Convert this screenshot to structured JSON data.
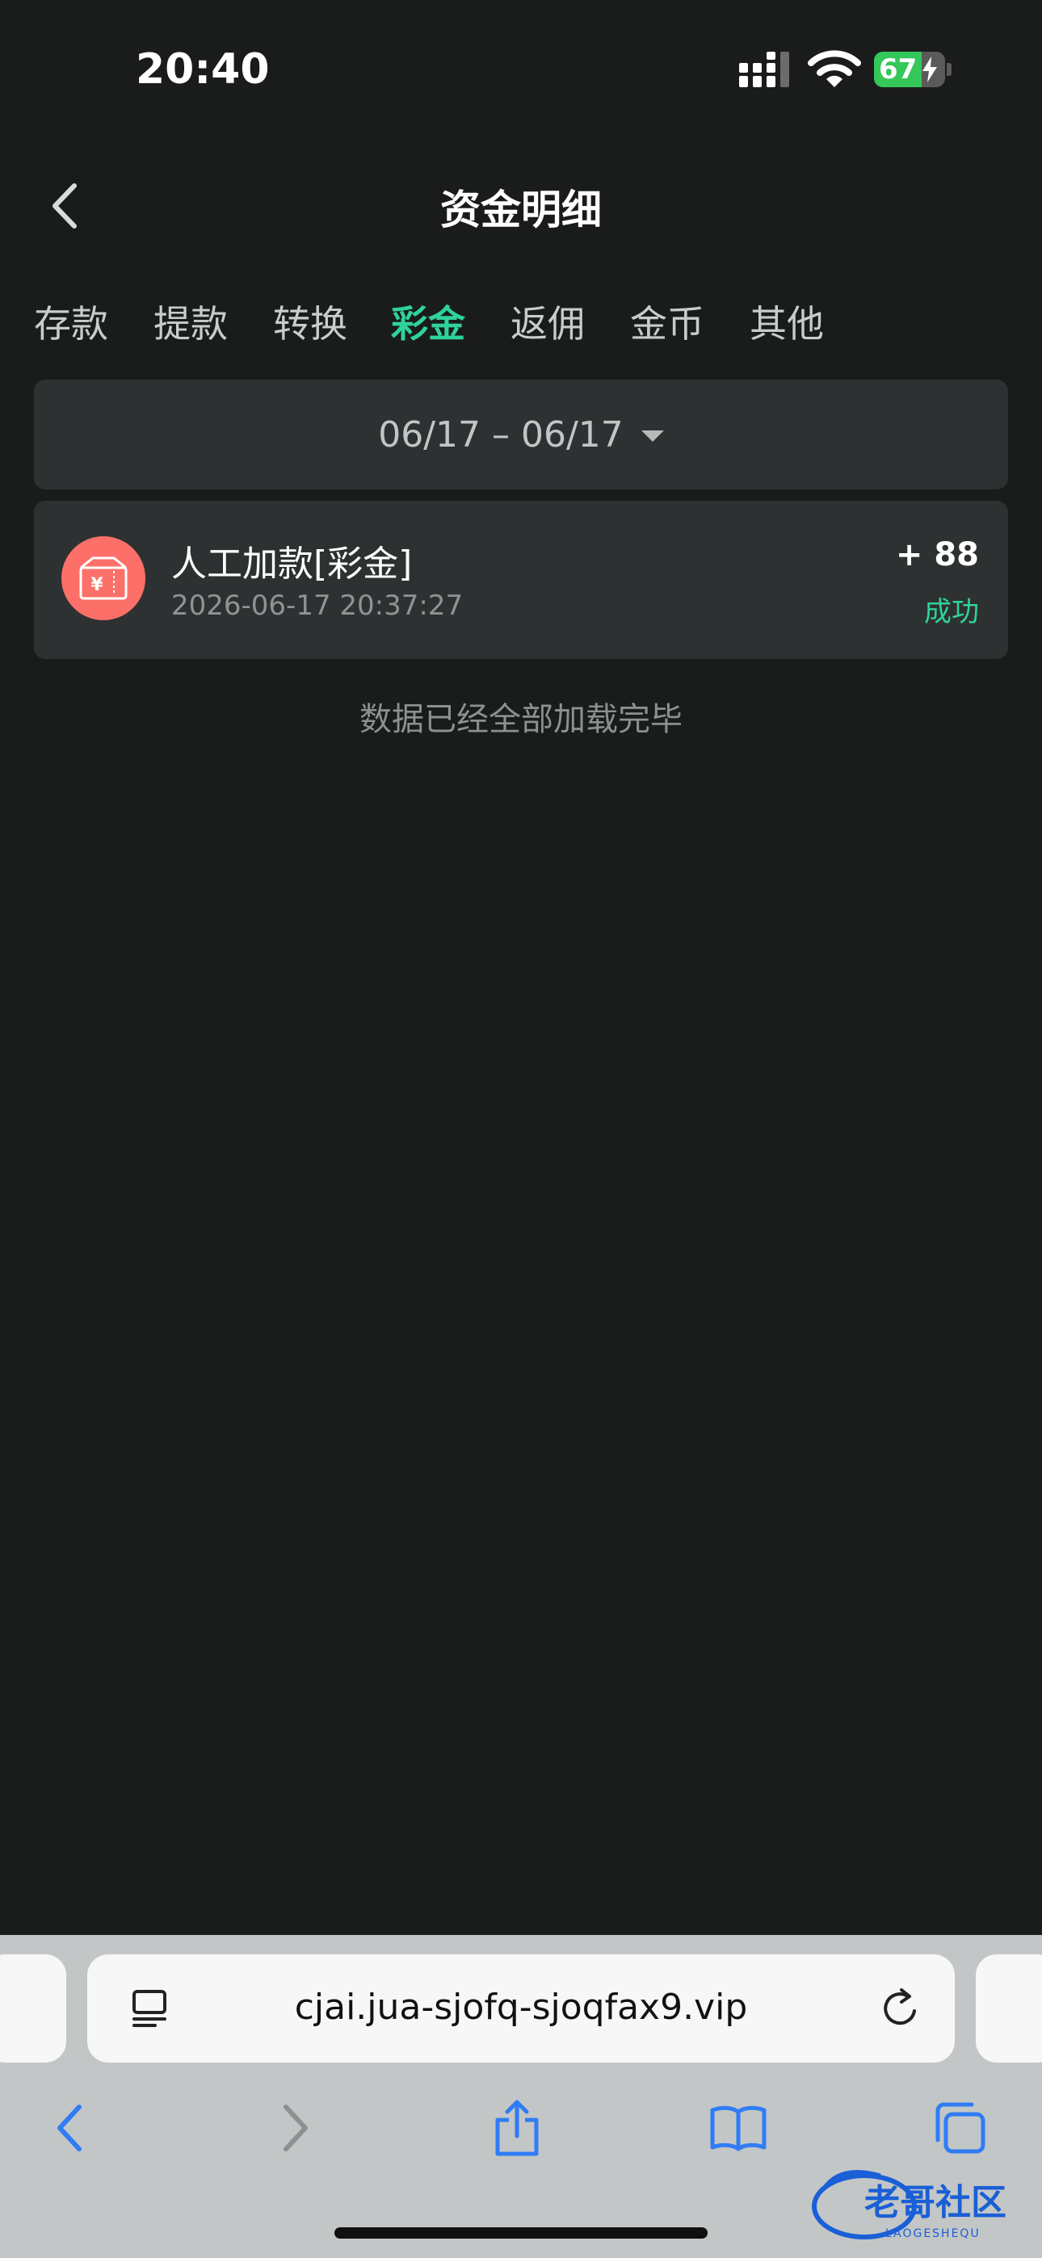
{
  "status_bar": {
    "time": "20:40",
    "battery_percent": "67",
    "battery_level": 0.67
  },
  "header": {
    "title": "资金明细",
    "back_icon": "chevron-left-icon"
  },
  "tabs": [
    {
      "label": "存款",
      "active": false
    },
    {
      "label": "提款",
      "active": false
    },
    {
      "label": "转换",
      "active": false
    },
    {
      "label": "彩金",
      "active": true
    },
    {
      "label": "返佣",
      "active": false
    },
    {
      "label": "金币",
      "active": false
    },
    {
      "label": "其他",
      "active": false
    }
  ],
  "date_filter": {
    "range": "06/17 – 06/17",
    "icon": "caret-down-icon"
  },
  "records": [
    {
      "title": "人工加款[彩金]",
      "time": "2026-06-17 20:37:27",
      "amount": "+ 88",
      "status": "成功",
      "icon": "red-envelope-icon"
    }
  ],
  "end_note": "数据已经全部加载完毕",
  "browser": {
    "url": "cjai.jua-sjofq-sjoqfax9.vip"
  },
  "watermark": {
    "text": "老哥社区",
    "subtext": "LAOGESHEQU"
  },
  "colors": {
    "background": "#1a1c1c",
    "card": "#2e3132",
    "accent": "#2fd39a",
    "icon_red": "#fd7069",
    "safari_blue": "#2f7cf6"
  }
}
